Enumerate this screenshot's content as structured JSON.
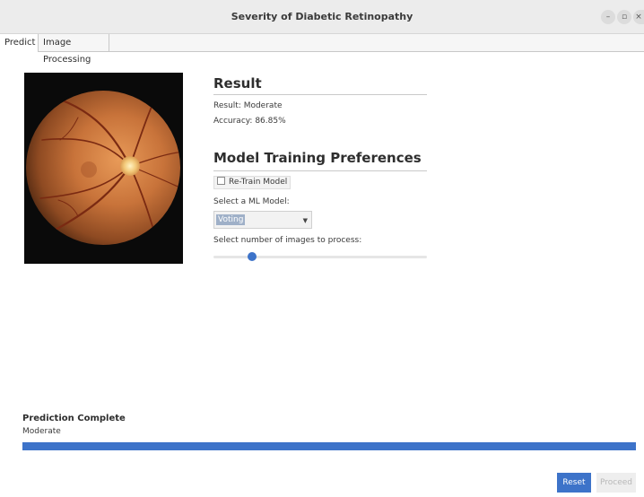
{
  "window": {
    "title": "Severity of Diabetic Retinopathy",
    "controls": {
      "minimize": "–",
      "maximize": "▫",
      "close": "×"
    }
  },
  "tabs": [
    {
      "label": "Predict",
      "active": true
    },
    {
      "label": "Image Processing",
      "active": false
    }
  ],
  "image": {
    "icon": "retina-fundus-image"
  },
  "result": {
    "heading": "Result",
    "result_text": "Result: Moderate",
    "accuracy_text": "Accuracy: 86.85%"
  },
  "preferences": {
    "heading": "Model Training Preferences",
    "retrain_label": "Re-Train Model",
    "retrain_checked": false,
    "model_label": "Select a ML Model:",
    "model_value": "Voting",
    "images_label": "Select number of images to process:",
    "images_slider_fraction": 0.18
  },
  "status": {
    "title": "Prediction Complete",
    "value": "Moderate",
    "progress_fraction": 1.0
  },
  "buttons": {
    "reset": "Reset",
    "proceed": "Proceed"
  },
  "colors": {
    "accent": "#3d73c9",
    "titlebar": "#ececec"
  }
}
